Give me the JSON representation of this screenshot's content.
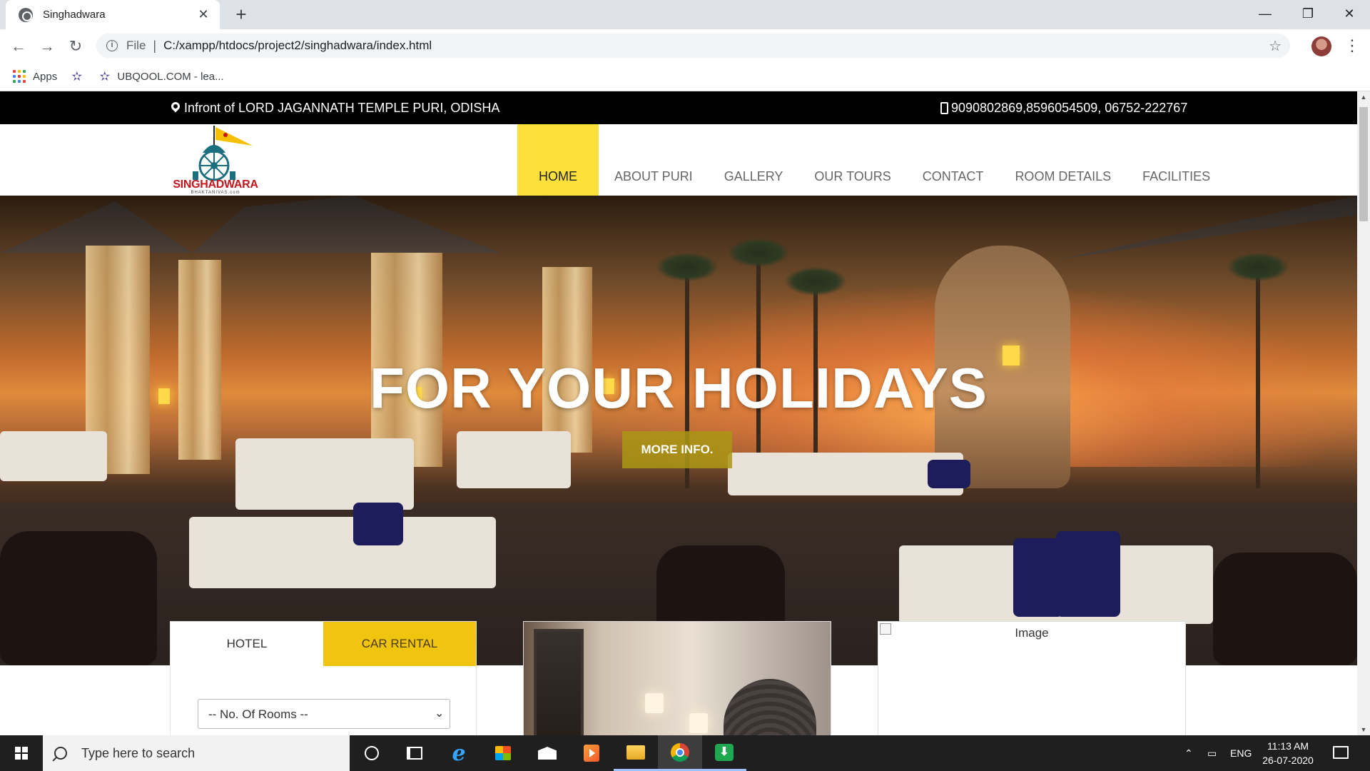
{
  "browser": {
    "tab_title": "Singhadwara",
    "scheme": "File",
    "url": "C:/xampp/htdocs/project2/singhadwara/index.html",
    "bookmarks": [
      {
        "label": "Apps"
      },
      {
        "label": ""
      },
      {
        "label": "UBQOOL.COM - lea..."
      }
    ]
  },
  "site": {
    "address": "Infront of LORD JAGANNATH TEMPLE PURI, ODISHA",
    "phones": "9090802869,8596054509, 06752-222767",
    "logo_text": "SINGHADWARA",
    "logo_sub": "BHAKTANIVAS.com",
    "nav": [
      {
        "label": "HOME",
        "active": true
      },
      {
        "label": "ABOUT PURI"
      },
      {
        "label": "GALLERY"
      },
      {
        "label": "OUR TOURS"
      },
      {
        "label": "CONTACT"
      },
      {
        "label": "ROOM DETAILS"
      },
      {
        "label": "FACILITIES"
      }
    ],
    "hero_title": "FOR YOUR HOLIDAYS",
    "hero_button": "MORE INFO.",
    "booking": {
      "tab_hotel": "HOTEL",
      "tab_car": "CAR RENTAL",
      "rooms_select": "-- No. Of Rooms --"
    },
    "broken_image_alt": "Image"
  },
  "taskbar": {
    "search_placeholder": "Type here to search",
    "language": "ENG",
    "time": "11:13 AM",
    "date": "26-07-2020"
  },
  "colors": {
    "accent_yellow": "#fde13a",
    "tab_yellow": "#f1c40f",
    "topbar_black": "#000000",
    "logo_red": "#c4161c"
  }
}
